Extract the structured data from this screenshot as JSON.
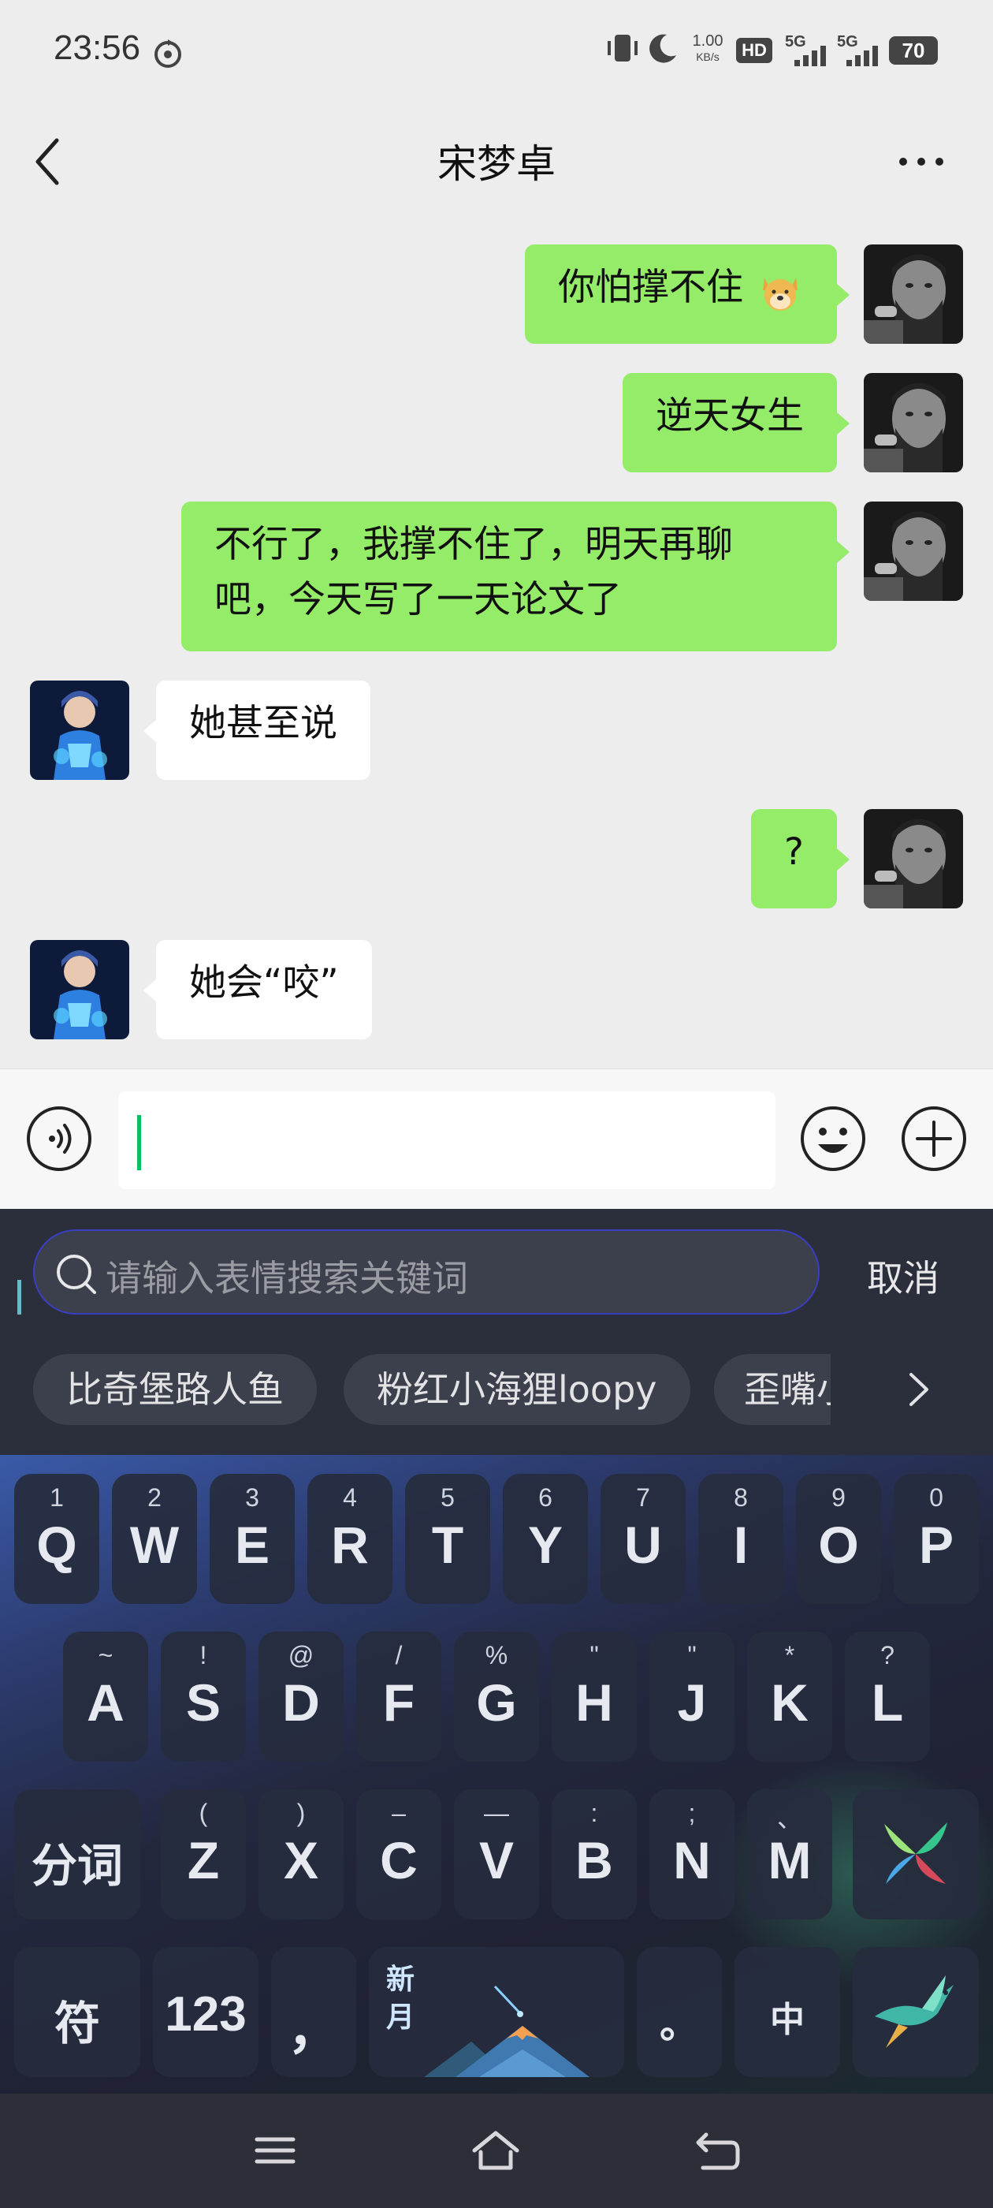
{
  "status_bar": {
    "time": "23:56",
    "net_speed_value": "1.00",
    "net_speed_unit": "KB/s",
    "hd_label": "HD",
    "sim1_label": "5G",
    "sim2_label": "5G",
    "battery": "70"
  },
  "header": {
    "title": "宋梦卓"
  },
  "messages": [
    {
      "side": "me",
      "text": "你怕撑不住"
    },
    {
      "side": "me",
      "text": "逆天女生"
    },
    {
      "side": "me",
      "text": "不行了，我撑不住了，明天再聊吧，今天写了一天论文了"
    },
    {
      "side": "other",
      "text": "她甚至说"
    },
    {
      "side": "me",
      "text": "?"
    },
    {
      "side": "other",
      "text": "她会“咬”"
    }
  ],
  "input": {
    "value": ""
  },
  "emoji_search": {
    "placeholder": "请输入表情搜索关键词",
    "cancel_label": "取消",
    "chips": [
      "比奇堡路人鱼",
      "粉红小海狸loopy",
      "歪嘴小"
    ]
  },
  "keyboard": {
    "row1": [
      {
        "main": "Q",
        "sub": "1"
      },
      {
        "main": "W",
        "sub": "2"
      },
      {
        "main": "E",
        "sub": "3"
      },
      {
        "main": "R",
        "sub": "4"
      },
      {
        "main": "T",
        "sub": "5"
      },
      {
        "main": "Y",
        "sub": "6"
      },
      {
        "main": "U",
        "sub": "7"
      },
      {
        "main": "I",
        "sub": "8"
      },
      {
        "main": "O",
        "sub": "9"
      },
      {
        "main": "P",
        "sub": "0"
      }
    ],
    "row2": [
      {
        "main": "A",
        "sub": "~"
      },
      {
        "main": "S",
        "sub": "!"
      },
      {
        "main": "D",
        "sub": "@"
      },
      {
        "main": "F",
        "sub": "/"
      },
      {
        "main": "G",
        "sub": "%"
      },
      {
        "main": "H",
        "sub": "\""
      },
      {
        "main": "J",
        "sub": "\""
      },
      {
        "main": "K",
        "sub": "*"
      },
      {
        "main": "L",
        "sub": "?"
      }
    ],
    "row3": [
      {
        "main": "Z",
        "sub": "("
      },
      {
        "main": "X",
        "sub": ")"
      },
      {
        "main": "C",
        "sub": "–"
      },
      {
        "main": "V",
        "sub": "—"
      },
      {
        "main": "B",
        "sub": ":"
      },
      {
        "main": "N",
        "sub": ";"
      },
      {
        "main": "M",
        "sub": "、"
      }
    ],
    "split_key": "分词",
    "symbol_key": "符",
    "number_key": "123",
    "comma_key": "，",
    "space_line1": "新",
    "space_line2": "月",
    "period_key": "。",
    "lang_key": "中"
  },
  "colors": {
    "my_bubble": "#95ec69",
    "other_bubble": "#ffffff",
    "chat_bg": "#ededed",
    "accent_caret": "#07c160"
  }
}
